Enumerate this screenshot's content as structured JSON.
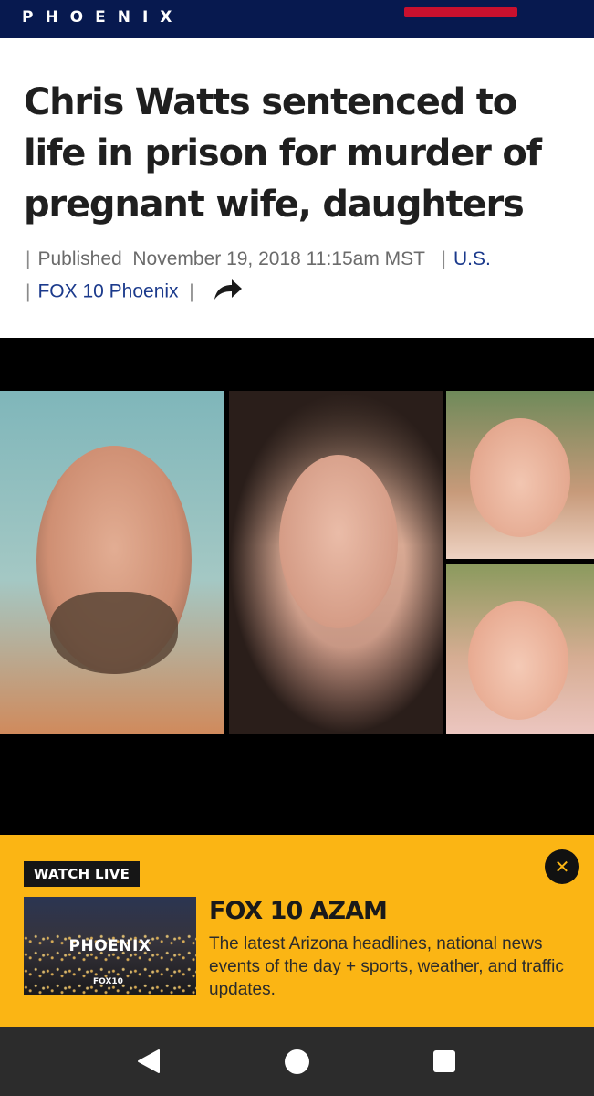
{
  "header": {
    "brand": "PHOENIX",
    "bar_color": "#07194f",
    "accent_color": "#c8102e"
  },
  "article": {
    "headline": "Chris Watts sentenced to life in prison for murder of pregnant wife, daughters",
    "published_label": "Published",
    "published_date": "November 19, 2018 11:15am MST",
    "category": "U.S.",
    "source": "FOX 10 Phoenix",
    "share_icon": "share-arrow-icon"
  },
  "banner": {
    "badge": "WATCH LIVE",
    "close_icon": "close-icon",
    "thumbnail_city": "PHOENIX",
    "thumbnail_logo": "FOX10",
    "title": "FOX 10 AZAM",
    "description": "The latest Arizona headlines, national news events of the day + sports, weather, and traffic updates.",
    "background_color": "#fbb514"
  },
  "navbar": {
    "back_icon": "back-triangle-icon",
    "home_icon": "home-circle-icon",
    "recents_icon": "recents-square-icon"
  }
}
